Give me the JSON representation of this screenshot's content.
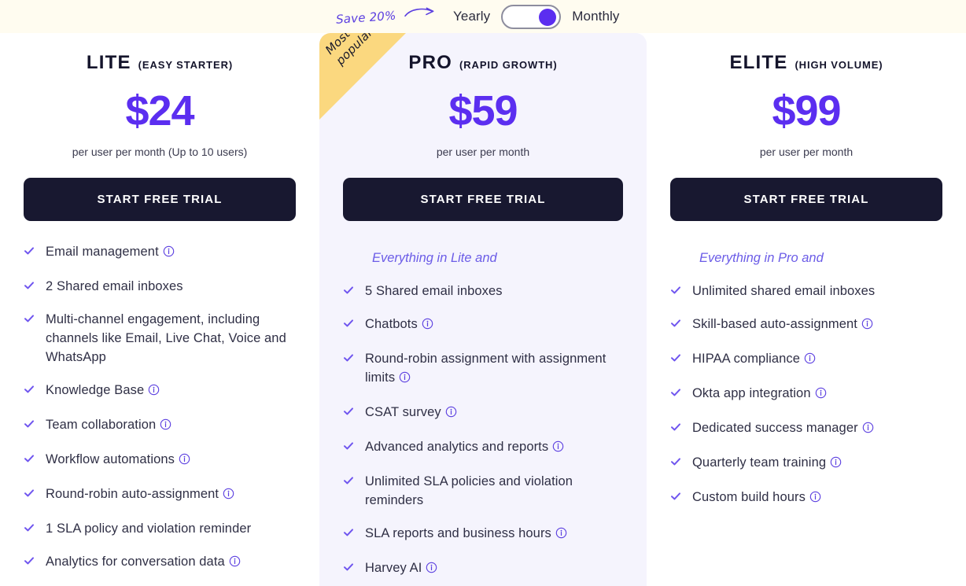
{
  "billing": {
    "save_badge": "Save 20%",
    "save_arrow_icon": "curved-arrow-icon",
    "yearly_label": "Yearly",
    "monthly_label": "Monthly",
    "toggle_state": "Monthly",
    "accent_color": "#5b2ef0",
    "band_color": "#fffcf0"
  },
  "icons": {
    "check": "check-icon",
    "info": "info-icon"
  },
  "plans": [
    {
      "name": "LITE",
      "tag": "(EASY STARTER)",
      "price": "$24",
      "price_note": "per user per month (Up to 10 users)",
      "cta": "START FREE TRIAL",
      "everything": null,
      "featured": false,
      "ribbon": null,
      "features": [
        {
          "text": "Email management",
          "info": true
        },
        {
          "text": "2 Shared email inboxes",
          "info": false
        },
        {
          "text": "Multi-channel engagement, including channels like Email, Live Chat, Voice and WhatsApp",
          "info": false
        },
        {
          "text": "Knowledge Base",
          "info": true
        },
        {
          "text": "Team collaboration",
          "info": true
        },
        {
          "text": "Workflow automations",
          "info": true
        },
        {
          "text": "Round-robin auto-assignment",
          "info": true
        },
        {
          "text": "1 SLA policy and violation reminder",
          "info": false
        },
        {
          "text": "Analytics for conversation data",
          "info": true
        }
      ]
    },
    {
      "name": "PRO",
      "tag": "(RAPID GROWTH)",
      "price": "$59",
      "price_note": "per user per month",
      "cta": "START FREE TRIAL",
      "everything": "Everything in Lite and",
      "featured": true,
      "ribbon": "Most popular",
      "ribbon_color": "#fbd87f",
      "features": [
        {
          "text": "5 Shared email inboxes",
          "info": false
        },
        {
          "text": "Chatbots",
          "info": true
        },
        {
          "text": "Round-robin assignment with assignment limits",
          "info": true
        },
        {
          "text": "CSAT survey",
          "info": true
        },
        {
          "text": "Advanced analytics and reports",
          "info": true
        },
        {
          "text": "Unlimited SLA policies and violation reminders",
          "info": false
        },
        {
          "text": "SLA reports and business hours",
          "info": true
        },
        {
          "text": "Harvey AI",
          "info": true
        }
      ]
    },
    {
      "name": "ELITE",
      "tag": "(HIGH VOLUME)",
      "price": "$99",
      "price_note": "per user per month",
      "cta": "START FREE TRIAL",
      "everything": "Everything in Pro and",
      "featured": false,
      "ribbon": null,
      "features": [
        {
          "text": "Unlimited shared email inboxes",
          "info": false
        },
        {
          "text": "Skill-based auto-assignment",
          "info": true
        },
        {
          "text": "HIPAA compliance",
          "info": true
        },
        {
          "text": "Okta app integration",
          "info": true
        },
        {
          "text": "Dedicated success manager",
          "info": true
        },
        {
          "text": "Quarterly team training",
          "info": true
        },
        {
          "text": "Custom build hours",
          "info": true
        }
      ]
    }
  ]
}
